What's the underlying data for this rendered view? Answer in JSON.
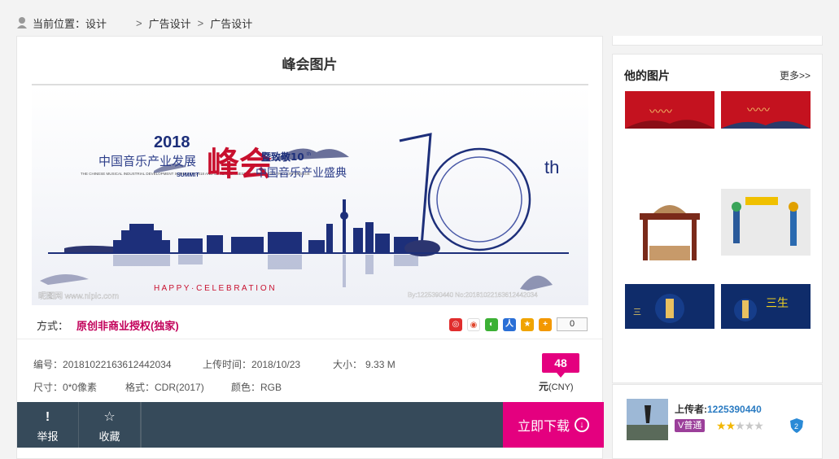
{
  "breadcrumb": {
    "label": "当前位置：",
    "items": [
      "设计",
      "广告设计",
      "广告设计"
    ]
  },
  "main": {
    "title": "峰会图片",
    "banner": {
      "year": "2018",
      "event_main": "中国音乐产业发展",
      "event_en": "THE CHINESE MUSICAL INDUSTRIAL DEVELOPMENT SUMMIT OF 2018 AND 40-YEAR CHINESE MUSICAL INDUSTRY CONFERENCE",
      "calligraphy": "峰会",
      "summit": "SUMMIT",
      "tribute": "暨致敬10",
      "tribute_sup": "th",
      "ceremony": "中国音乐产业盛典",
      "th": "th",
      "tagline": "H A P P Y · C E L E B R A T I O N",
      "watermark_left": "昵图网 www.nipic.com",
      "watermark_right": "By:1225390440  No:20181022163612442034"
    },
    "mode_label": "方式：",
    "mode_value": "原创非商业授权(独家)",
    "share_count": "0",
    "info": {
      "id_label": "编号：",
      "id": "20181022163612442034",
      "upload_label": "上传时间：",
      "upload": "2018/10/23",
      "size_label": "大小：",
      "size": "9.33 M",
      "dim_label": "尺寸：",
      "dim": "0*0像素",
      "format_label": "格式：",
      "format": "CDR(2017)",
      "color_label": "颜色：",
      "color": "RGB"
    },
    "price": "48",
    "currency": "元",
    "currency_code": "(CNY)",
    "actions": {
      "report": "举报",
      "favorite": "收藏",
      "download": "立即下载"
    }
  },
  "side": {
    "title": "他的图片",
    "more": "更多>>"
  },
  "uploader": {
    "label": "上传者:",
    "name": "1225390440",
    "vip": "V普通",
    "stars": 2,
    "level": "2"
  },
  "colors": {
    "accent": "#e4007f",
    "bar": "#364a5a",
    "link": "#2a7bc2"
  }
}
